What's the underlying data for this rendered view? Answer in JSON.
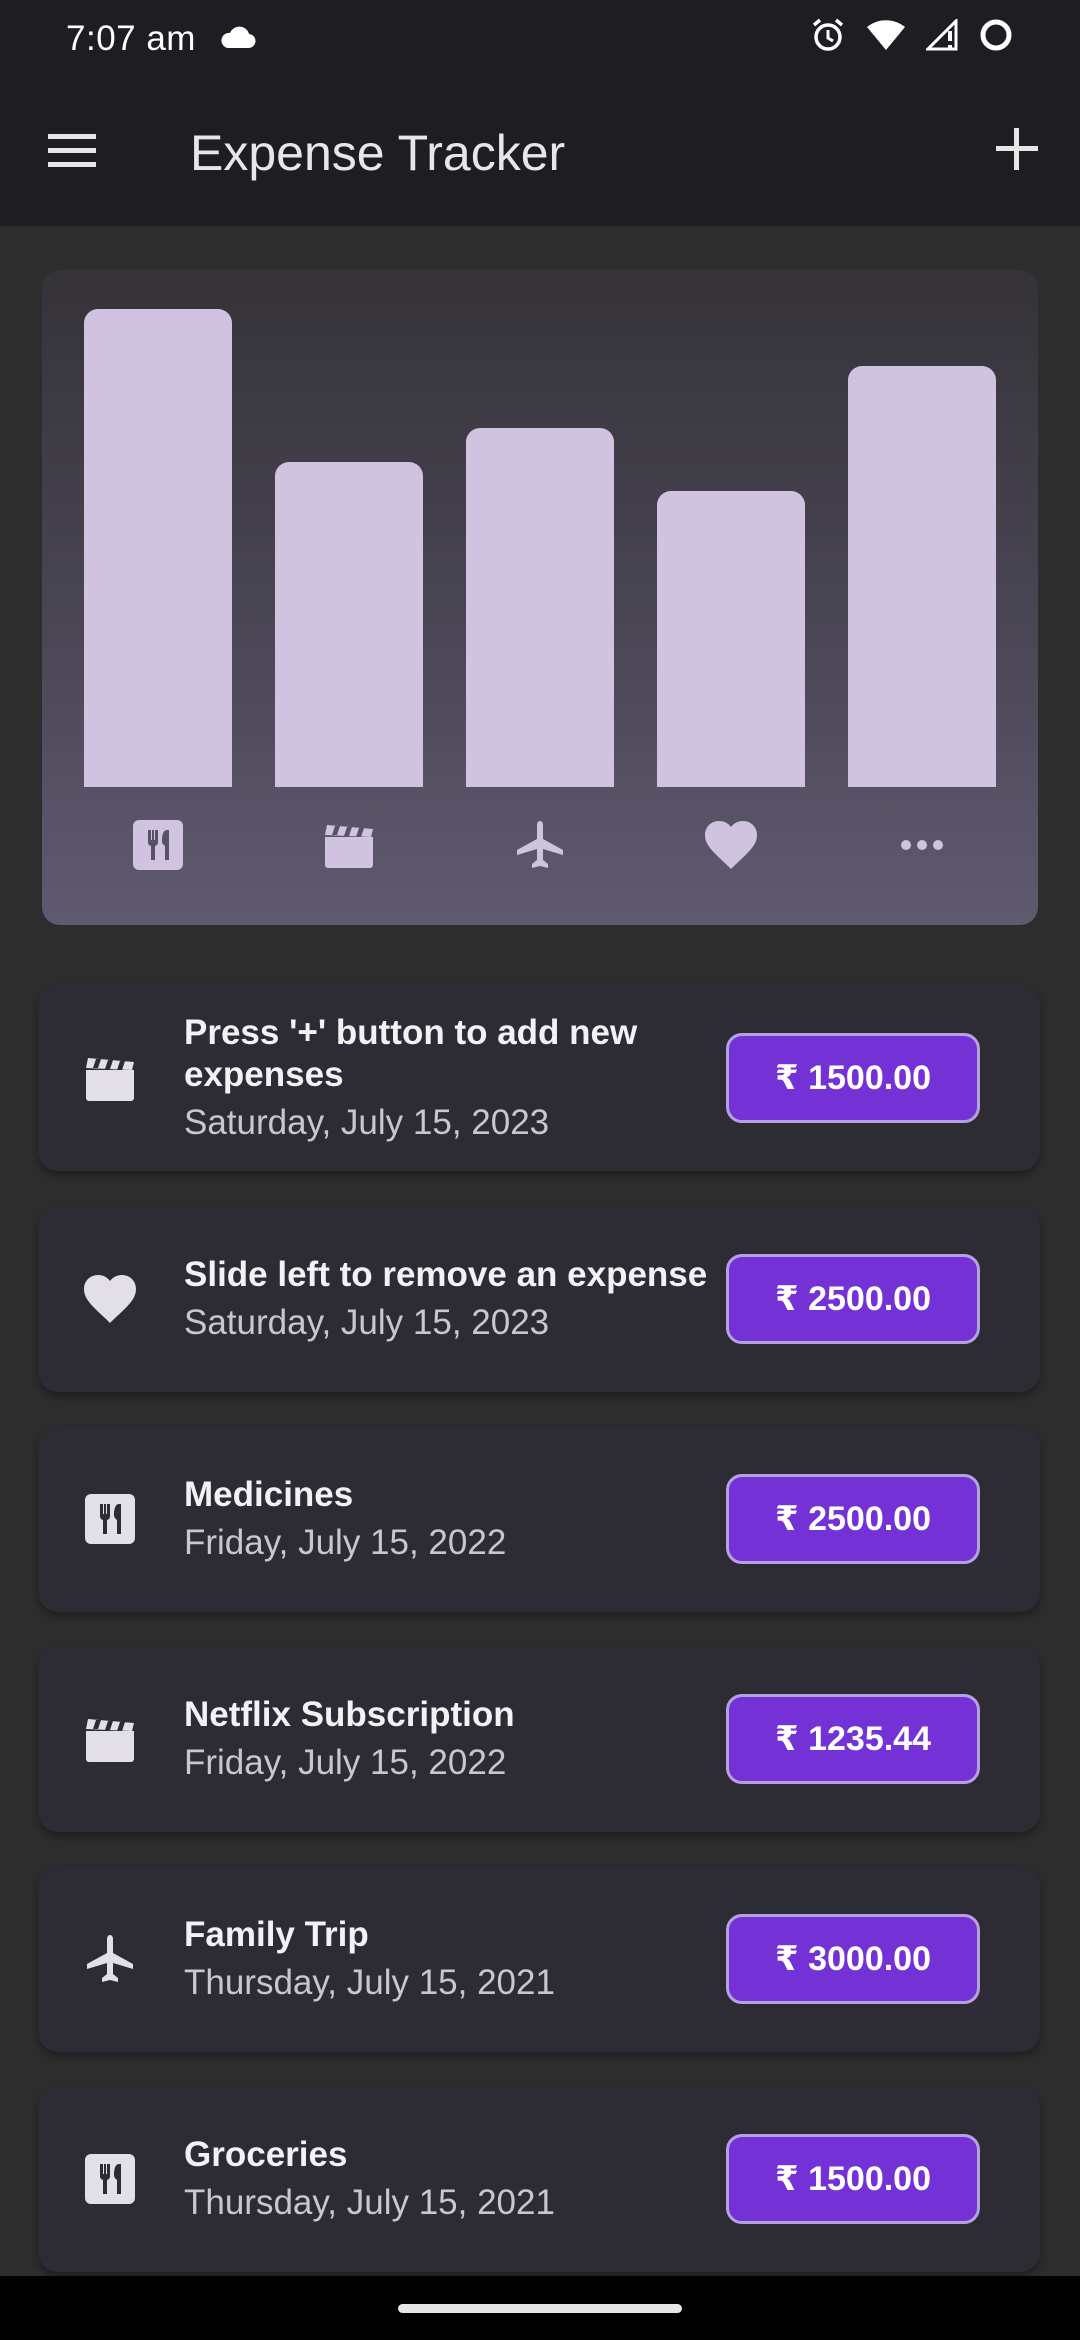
{
  "status_bar": {
    "time": "7:07 am",
    "icons": [
      "cloud-icon",
      "alarm-icon",
      "wifi-icon",
      "signal-icon",
      "battery-icon"
    ]
  },
  "app_bar": {
    "title": "Expense Tracker",
    "menu_icon": "menu-icon",
    "add_icon": "plus-icon"
  },
  "chart_data": {
    "type": "bar",
    "categories": [
      "food",
      "leisure",
      "travel",
      "health",
      "other"
    ],
    "category_icons": [
      "food-icon",
      "movie-icon",
      "flight-icon",
      "heart-icon",
      "more-icon"
    ],
    "values": [
      1.0,
      0.68,
      0.75,
      0.62,
      0.88
    ],
    "bar_color": "#cfc3e0"
  },
  "expenses": [
    {
      "category": "movie-icon",
      "title": "Press '+' button to add new expenses",
      "date": "Saturday, July 15, 2023",
      "amount": "₹ 1500.00"
    },
    {
      "category": "heart-icon",
      "title": "Slide left to remove an expense",
      "date": "Saturday, July 15, 2023",
      "amount": "₹ 2500.00"
    },
    {
      "category": "food-icon",
      "title": "Medicines",
      "date": "Friday, July 15, 2022",
      "amount": "₹ 2500.00"
    },
    {
      "category": "movie-icon",
      "title": "Netflix Subscription",
      "date": "Friday, July 15, 2022",
      "amount": "₹ 1235.44"
    },
    {
      "category": "flight-icon",
      "title": "Family Trip",
      "date": "Thursday, July 15, 2021",
      "amount": "₹ 3000.00"
    },
    {
      "category": "food-icon",
      "title": "Groceries",
      "date": "Thursday, July 15, 2021",
      "amount": "₹ 1500.00"
    }
  ],
  "colors": {
    "accent": "#7432d6",
    "surface": "#2d2b33",
    "app_bar": "#1e1d21",
    "background": "#2d2d2d"
  }
}
